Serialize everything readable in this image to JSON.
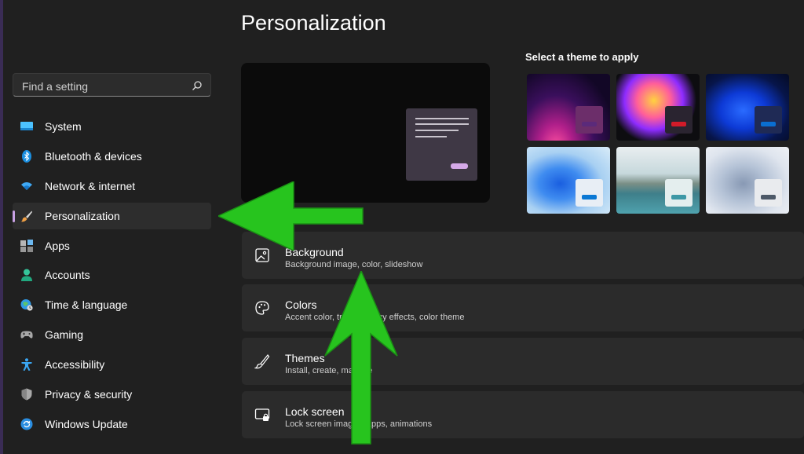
{
  "search": {
    "placeholder": "Find a setting",
    "icon": "search-icon"
  },
  "sidebar": {
    "items": [
      {
        "label": "System",
        "icon": "system-icon",
        "active": false
      },
      {
        "label": "Bluetooth & devices",
        "icon": "bluetooth-icon",
        "active": false
      },
      {
        "label": "Network & internet",
        "icon": "wifi-icon",
        "active": false
      },
      {
        "label": "Personalization",
        "icon": "brush-icon",
        "active": true
      },
      {
        "label": "Apps",
        "icon": "apps-icon",
        "active": false
      },
      {
        "label": "Accounts",
        "icon": "account-icon",
        "active": false
      },
      {
        "label": "Time & language",
        "icon": "globe-clock-icon",
        "active": false
      },
      {
        "label": "Gaming",
        "icon": "gamepad-icon",
        "active": false
      },
      {
        "label": "Accessibility",
        "icon": "accessibility-icon",
        "active": false
      },
      {
        "label": "Privacy & security",
        "icon": "shield-icon",
        "active": false
      },
      {
        "label": "Windows Update",
        "icon": "update-icon",
        "active": false
      }
    ]
  },
  "main": {
    "title": "Personalization",
    "themes_title": "Select a theme to apply",
    "themes": [
      {
        "name": "glow",
        "chip_color": "#6c2e6a",
        "bar_color": "#5b2a7a"
      },
      {
        "name": "captured-motion",
        "chip_color": "#2a2430",
        "bar_color": "#d11b29"
      },
      {
        "name": "windows-dark",
        "chip_color": "#1f2a55",
        "bar_color": "#0a6ed1"
      },
      {
        "name": "windows-light",
        "chip_color": "#e8eef5",
        "bar_color": "#0a78d4"
      },
      {
        "name": "sunrise",
        "chip_color": "#e4eeee",
        "bar_color": "#3d98a6"
      },
      {
        "name": "flow",
        "chip_color": "#e9ebee",
        "bar_color": "#4d5968"
      }
    ],
    "cards": [
      {
        "title": "Background",
        "subtitle": "Background image, color, slideshow",
        "icon": "image-icon"
      },
      {
        "title": "Colors",
        "subtitle": "Accent color, transparency effects, color theme",
        "icon": "palette-icon"
      },
      {
        "title": "Themes",
        "subtitle": "Install, create, manage",
        "icon": "pen-brush-icon"
      },
      {
        "title": "Lock screen",
        "subtitle": "Lock screen images, apps, animations",
        "icon": "lock-screen-icon"
      }
    ]
  },
  "annotations": {
    "arrow_color": "#27c41e"
  },
  "colors": {
    "accent": "#c9a2e6",
    "background": "#202020",
    "card": "#2b2b2b"
  }
}
